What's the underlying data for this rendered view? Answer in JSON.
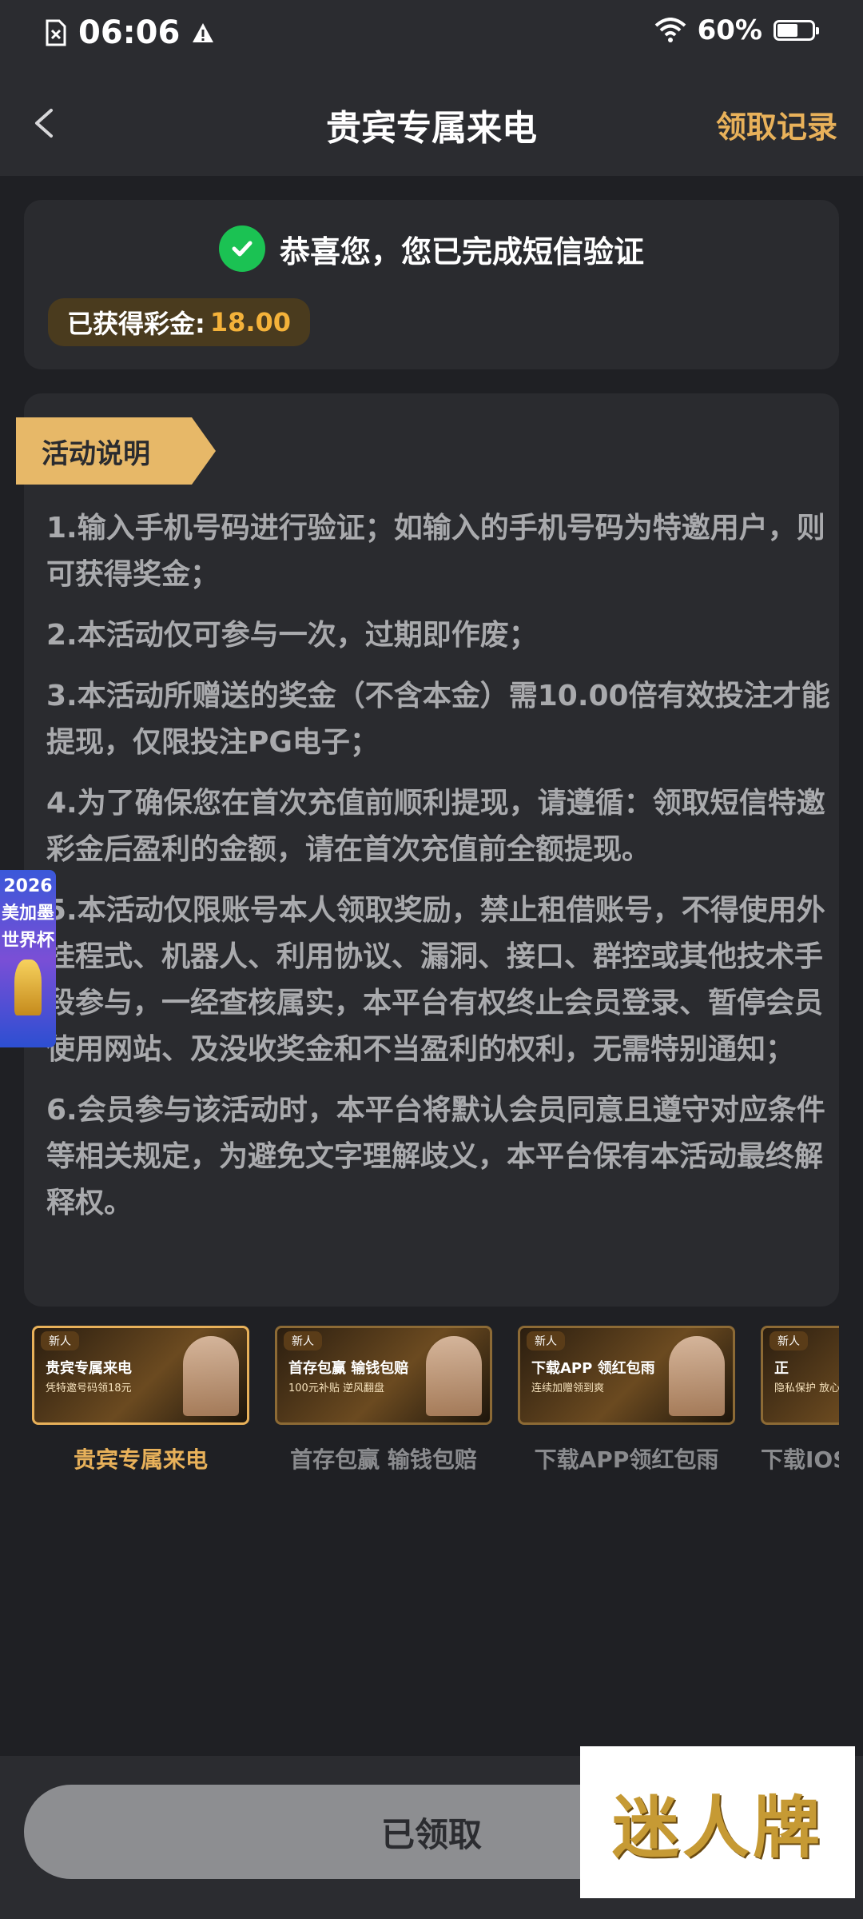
{
  "status_bar": {
    "time": "06:06",
    "battery": "60%"
  },
  "header": {
    "title": "贵宾专属来电",
    "records_link": "领取记录"
  },
  "verification": {
    "message": "恭喜您，您已完成短信验证",
    "earned_label": "已获得彩金:",
    "earned_amount": "18.00"
  },
  "activity": {
    "ribbon_label": "活动说明",
    "rules": [
      "1.输入手机号码进行验证；如输入的手机号码为特邀用户，则可获得奖金；",
      "2.本活动仅可参与一次，过期即作废；",
      "3.本活动所赠送的奖金（不含本金）需10.00倍有效投注才能提现，仅限投注PG电子；",
      "4.为了确保您在首次充值前顺利提现，请遵循：领取短信特邀彩金后盈利的金额，请在首次充值前全额提现。",
      "5.本活动仅限账号本人领取奖励，禁止租借账号，不得使用外挂程式、机器人、利用协议、漏洞、接口、群控或其他技术手段参与，一经查核属实，本平台有权终止会员登录、暂停会员使用网站、及没收奖金和不当盈利的权利，无需特别通知；",
      "6.会员参与该活动时，本平台将默认会员同意且遵守对应条件等相关规定，为避免文字理解歧义，本平台保有本活动最终解释权。"
    ]
  },
  "float_ad": {
    "line1": "2026",
    "line2": "美加墨",
    "line3": "世界杯"
  },
  "promo_tabs": [
    {
      "label": "贵宾专属来电",
      "tag": "新人",
      "banner_title": "贵宾专属来电",
      "banner_sub": "凭特邀号码领18元"
    },
    {
      "label": "首存包赢 输钱包赔",
      "tag": "新人",
      "banner_title": "首存包赢 输钱包赔",
      "banner_sub": "100元补贴 逆风翻盘"
    },
    {
      "label": "下载APP领红包雨",
      "tag": "新人",
      "banner_title": "下载APP 领红包雨",
      "banner_sub": "连续加赠领到爽"
    },
    {
      "label": "下载IOS",
      "tag": "新人",
      "banner_title": "正",
      "banner_sub": "隐私保护 放心"
    }
  ],
  "footer": {
    "button_label": "已领取"
  },
  "watermark": {
    "text": "迷人牌"
  },
  "colors": {
    "accent": "#e8b15a",
    "success": "#1bc253",
    "background": "#1f2024",
    "card": "#2a2b2f"
  }
}
